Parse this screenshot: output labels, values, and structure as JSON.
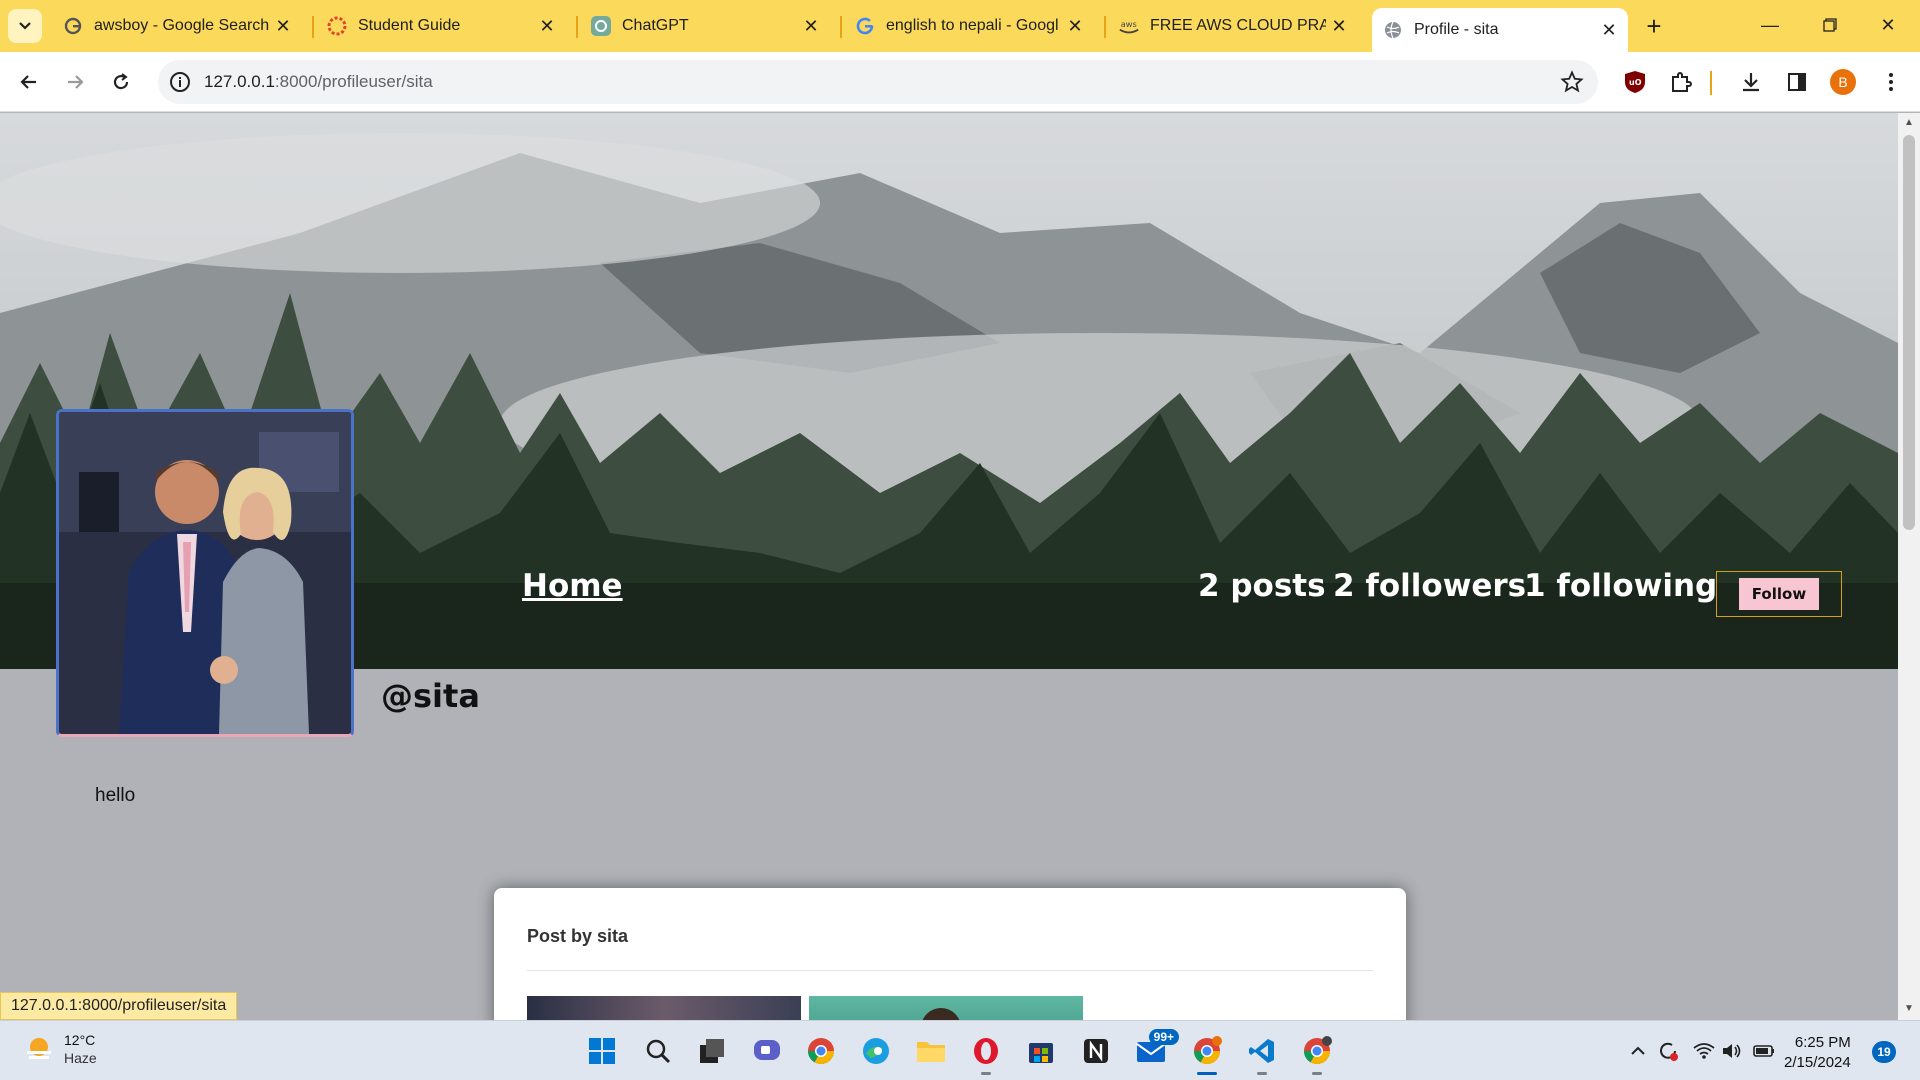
{
  "browser": {
    "tabs": [
      {
        "title": "awsboy - Google Search",
        "icon": "google-icon"
      },
      {
        "title": "Student Guide",
        "icon": "student-guide-icon"
      },
      {
        "title": "ChatGPT",
        "icon": "chatgpt-icon"
      },
      {
        "title": "english to nepali - Googl",
        "icon": "google-icon"
      },
      {
        "title": "FREE AWS CLOUD PRACT",
        "icon": "aws-course-icon"
      },
      {
        "title": "Profile - sita",
        "icon": "globe-icon",
        "active": true
      }
    ],
    "url_host": "127.0.0.1",
    "url_path": ":8000/profileuser/sita",
    "profile_initial": "B",
    "status_url": "127.0.0.1:8000/profileuser/sita"
  },
  "profile": {
    "nav_home": "Home",
    "posts": "2 posts",
    "followers": "2 followers",
    "following": "1 following",
    "follow_label": "Follow",
    "handle": "@sita",
    "bio": "hello",
    "post_card_title": "Post by sita"
  },
  "taskbar": {
    "temperature": "12°C",
    "condition": "Haze",
    "mail_badge": "99+",
    "time": "6:25 PM",
    "date": "2/15/2024",
    "notifications": "19"
  },
  "colors": {
    "tab_strip": "#fbd95a",
    "page_bg": "#b0b2b7",
    "follow_button": "#f7c6d2",
    "follow_border": "#d4a017",
    "avatar_border": "#4a72c8"
  }
}
